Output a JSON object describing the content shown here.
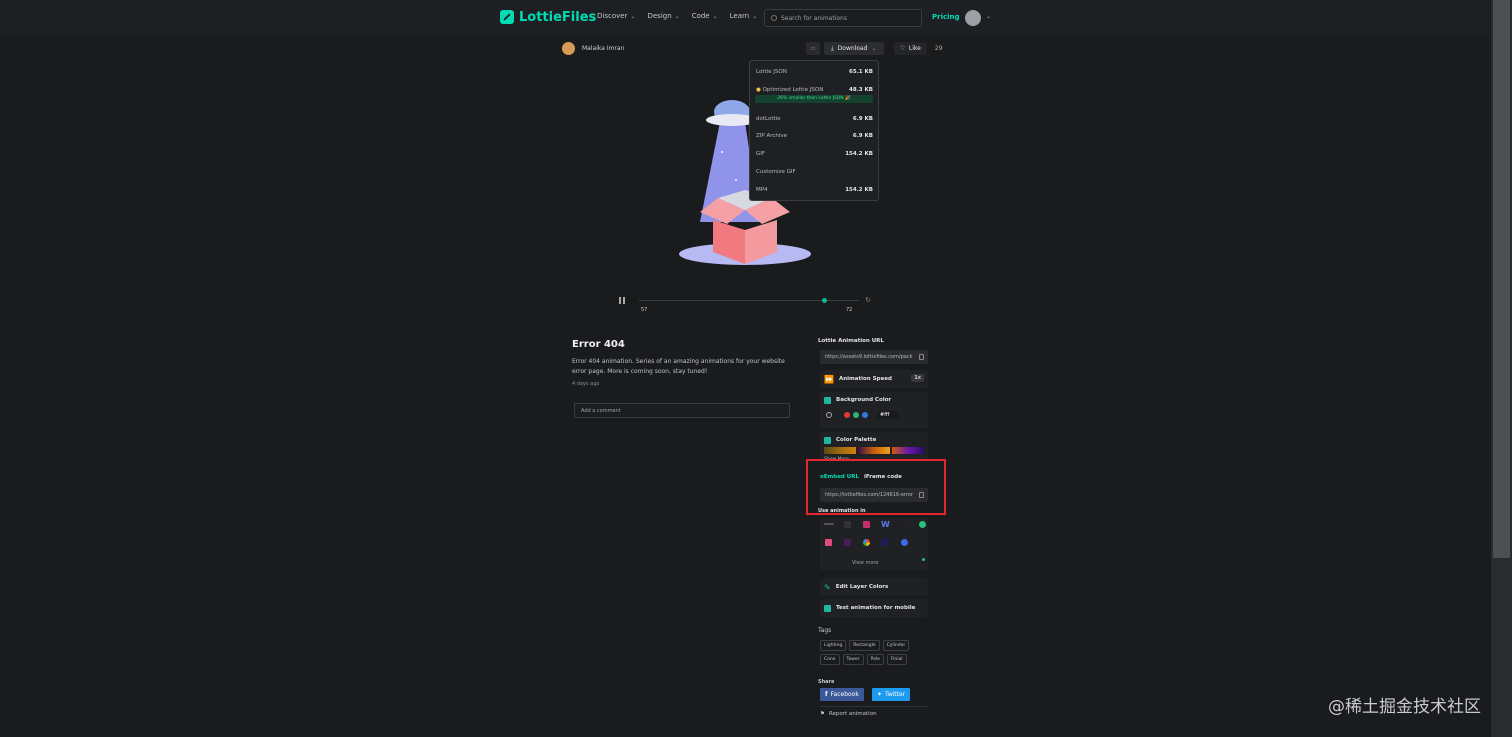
{
  "header": {
    "brand": "LottieFiles",
    "nav": [
      "Discover",
      "Design",
      "Code",
      "Learn"
    ],
    "search_placeholder": "Search for animations",
    "pricing": "Pricing"
  },
  "author": {
    "name": "Malaika Imran"
  },
  "actions": {
    "download": "Download",
    "like": "Like",
    "like_count": "29"
  },
  "download_menu": {
    "items": [
      {
        "label": "Lottie JSON",
        "size": "65.1 KB"
      },
      {
        "label": "Optimized Lottie JSON",
        "size": "48.3 KB"
      },
      {
        "label": "dotLottie",
        "size": "6.9 KB"
      },
      {
        "label": "ZIP Archive",
        "size": "6.9 KB"
      },
      {
        "label": "GIF",
        "size": "154.2 KB"
      },
      {
        "label": "Customize GIF",
        "size": ""
      },
      {
        "label": "MP4",
        "size": "154.2 KB"
      }
    ],
    "optimized_badge": "26% smaller than Lottie JSON 🎉"
  },
  "player": {
    "frame_current": "57",
    "frame_total": "72",
    "progress": 0.84
  },
  "animation": {
    "title": "Error 404",
    "description": "Error 404 animation. Series of an amazing animations for your website error page. More is coming soon, stay tuned!",
    "posted": "4 days ago",
    "comment_placeholder": "Add a comment"
  },
  "sidebar": {
    "lottie_url_label": "Lottie Animation URL",
    "lottie_url": "https://assets9.lottiefiles.com/pack",
    "animation_speed_label": "Animation Speed",
    "animation_speed": "1x",
    "background_color_label": "Background Color",
    "background_hex": "#fff",
    "color_palette_label": "Color Palette",
    "show_more": "Show More",
    "embed_tab": "oEmbed URL",
    "iframe_tab": "iFrame code",
    "embed_url": "https://lottiefiles.com/124616-error",
    "use_in_label": "Use animation in",
    "view_more": "View more",
    "edit_layer_colors": "Edit Layer Colors",
    "test_mobile": "Test animation for mobile",
    "tags_label": "Tags",
    "tags": [
      "Lighting",
      "Rectangle",
      "Cylinder",
      "Cone",
      "Tower",
      "Pole",
      "Finial"
    ],
    "share_label": "Share",
    "facebook": "Facebook",
    "twitter": "Twitter",
    "report": "Report animation"
  },
  "colors": {
    "accent": "#00ddb3",
    "highlight_box": "#e4262e",
    "facebook": "#3b5998",
    "twitter": "#1d9bf0"
  },
  "watermark": "@稀土掘金技术社区"
}
